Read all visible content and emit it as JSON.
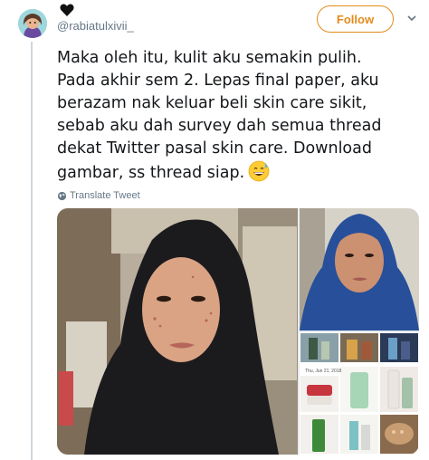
{
  "header": {
    "handle": "@rabiatulxivii_",
    "follow_label": "Follow"
  },
  "tweet": {
    "lines": [
      "Maka oleh itu, kulit aku semakin pulih.",
      "Pada akhir sem 2. Lepas final paper, aku",
      "berazam nak keluar beli skin care sikit,",
      "sebab aku dah survey dah semua thread",
      "dekat Twitter pasal skin care. Download",
      "gambar, ss thread siap."
    ],
    "translate_label": "Translate Tweet"
  },
  "media": {
    "collage_date": "Thu, Jun 21, 2018"
  },
  "colors": {
    "accent": "#e38b1b",
    "secondary_text": "#657786",
    "thread_line": "#ccd6dd"
  }
}
